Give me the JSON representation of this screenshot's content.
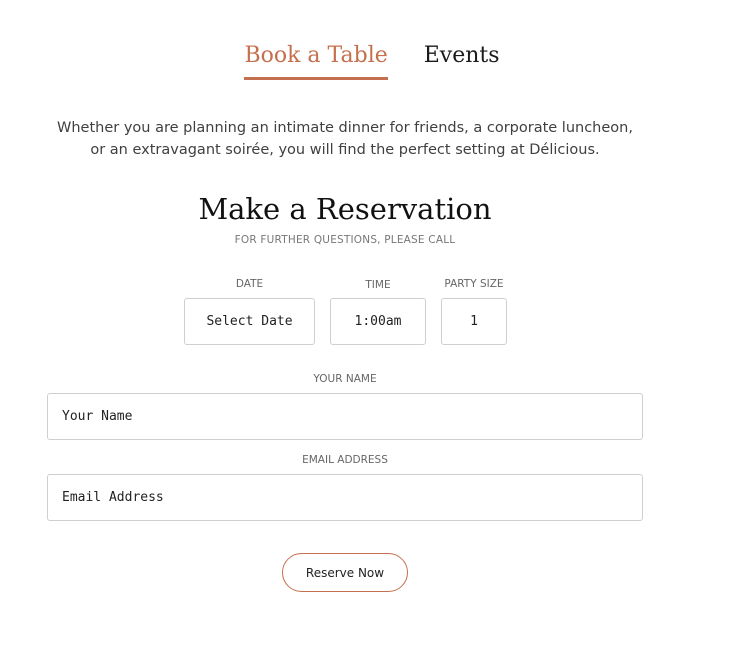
{
  "tabs": [
    {
      "label": "Book a Table",
      "active": true
    },
    {
      "label": "Events",
      "active": false
    }
  ],
  "intro": {
    "line1": "Whether you are planning an intimate dinner for friends, a corporate luncheon,",
    "line2": "or an extravagant soirée, you will find the perfect setting at Délicious."
  },
  "reservation": {
    "title": "Make a Reservation",
    "subtitle": "FOR FURTHER QUESTIONS, PLEASE CALL",
    "date": {
      "label": "DATE",
      "value": "Select Date"
    },
    "time": {
      "label": "TIME",
      "value": "1:00am"
    },
    "party_size": {
      "label": "PARTY SIZE",
      "value": "1"
    },
    "name": {
      "label": "YOUR NAME",
      "placeholder": "Your Name"
    },
    "email": {
      "label": "EMAIL ADDRESS",
      "placeholder": "Email Address"
    },
    "submit_label": "Reserve Now"
  },
  "colors": {
    "accent": "#c4704f",
    "border": "#cfcfcf",
    "text": "#333333"
  }
}
